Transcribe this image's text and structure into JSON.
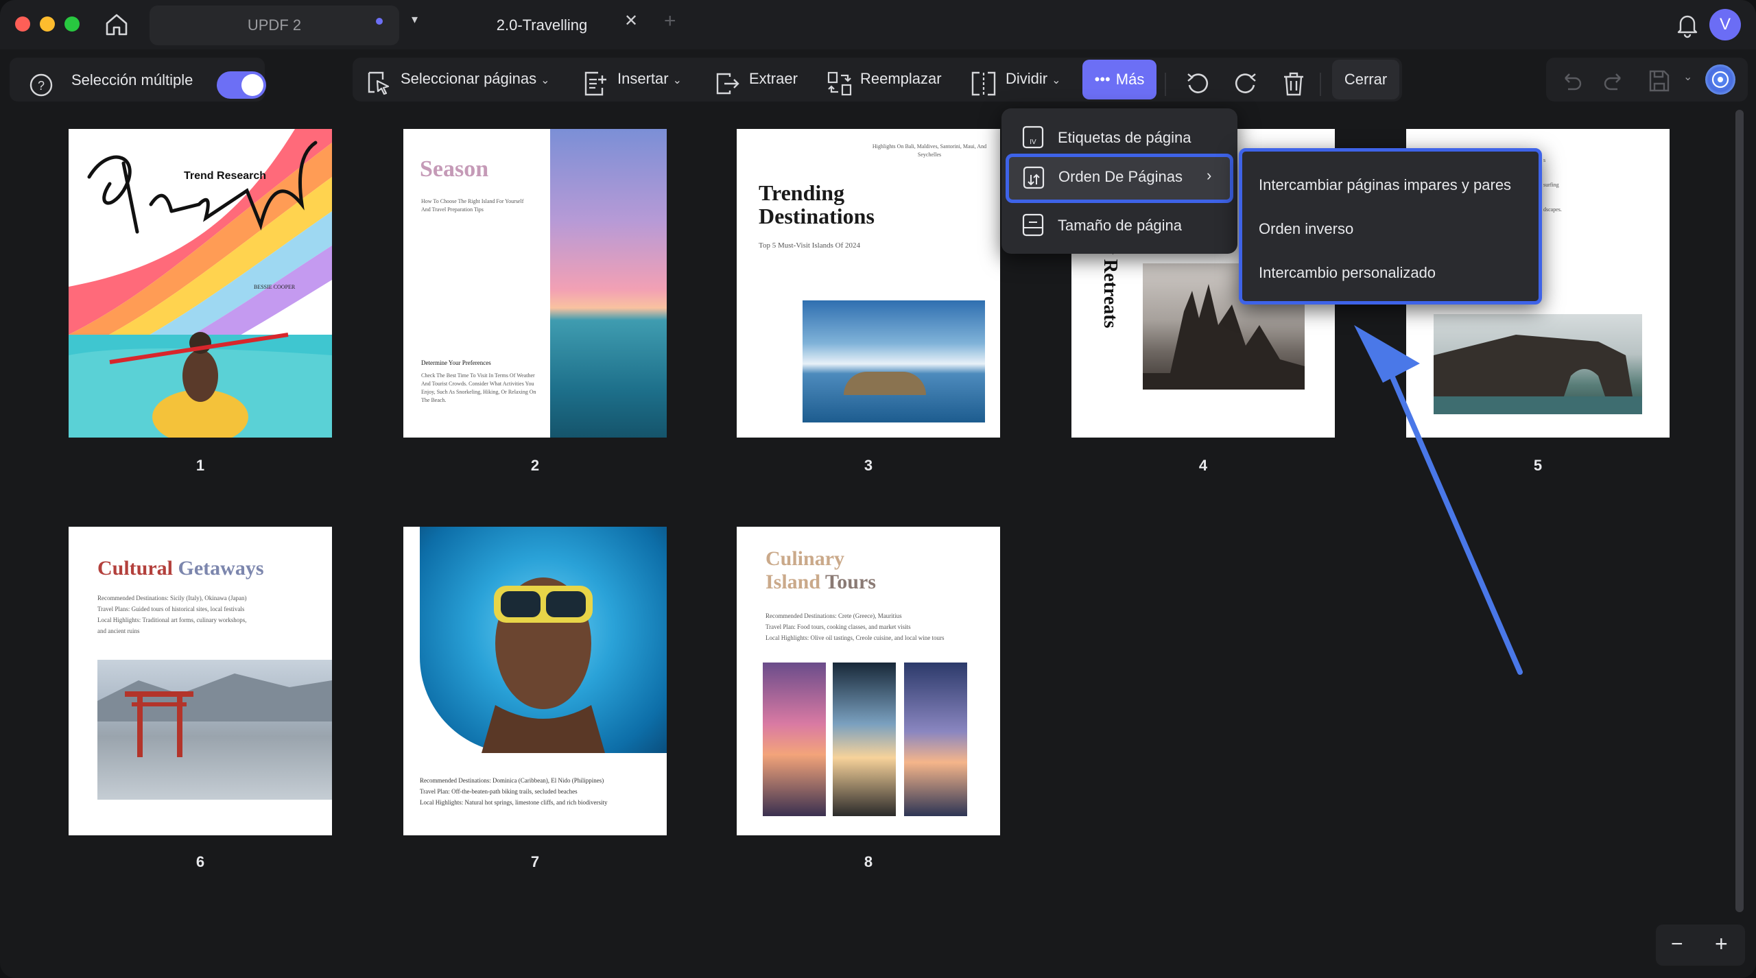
{
  "titlebar": {
    "tabs": [
      {
        "label": "UPDF 2"
      },
      {
        "label": "2.0-Travelling"
      }
    ],
    "avatar_initial": "V"
  },
  "toolbar": {
    "multi_select_label": "Selección múltiple",
    "multi_select_on": true,
    "select_pages_label": "Seleccionar páginas",
    "insert_label": "Insertar",
    "extract_label": "Extraer",
    "replace_label": "Reemplazar",
    "split_label": "Dividir",
    "more_label": "Más",
    "close_label": "Cerrar"
  },
  "more_menu": {
    "items": [
      {
        "label": "Etiquetas de página"
      },
      {
        "label": "Orden De Páginas",
        "arrow": "›"
      },
      {
        "label": "Tamaño de página"
      }
    ]
  },
  "order_submenu": {
    "items": [
      {
        "label": "Intercambiar páginas impares y pares"
      },
      {
        "label": "Orden inverso"
      },
      {
        "label": "Intercambio personalizado"
      }
    ]
  },
  "pages": [
    {
      "number": "1",
      "title": "Travel",
      "subtitle": "Trend Research",
      "author": "BESSIE COOPER"
    },
    {
      "number": "2",
      "title": "Season",
      "heading": "Determine Your Preferences"
    },
    {
      "number": "3",
      "title_line1": "Trending",
      "title_line2": "Destinations",
      "subtitle": "Top 5 Must-Visit Islands Of 2024"
    },
    {
      "number": "4",
      "title": "ndly Retreats"
    },
    {
      "number": "5"
    },
    {
      "number": "6",
      "title_part1": "Cultural ",
      "title_part2": "Getaways",
      "lines": [
        "Recommended Destinations: Sicily (Italy), Okinawa (Japan)",
        "Travel Plans: Guided tours of historical sites, local festivals",
        "Local Highlights: Traditional art forms, culinary workshops,",
        "and ancient ruins"
      ]
    },
    {
      "number": "7",
      "lines": [
        "Recommended Destinations: Dominica (Caribbean), El Nido (Philippines)",
        "Travel Plan: Off-the-beaten-path biking trails, secluded beaches",
        "Local Highlights: Natural hot springs, limestone cliffs, and rich biodiversity"
      ]
    },
    {
      "number": "8",
      "title_a1": "Culinary",
      "title_b1": "Island ",
      "title_b2": "Tours",
      "lines": [
        "Recommended Destinations: Crete (Greece), Mauritius",
        "Travel Plan: Food tours, cooking classes, and market visits",
        "Local Highlights: Olive oil tastings, Creole cuisine, and local wine tours"
      ]
    }
  ],
  "zoom": {
    "minus": "−",
    "plus": "+"
  },
  "colors": {
    "accent": "#6c6ff5",
    "highlight_border": "#3e63e8",
    "arrow": "#4a78e8"
  }
}
